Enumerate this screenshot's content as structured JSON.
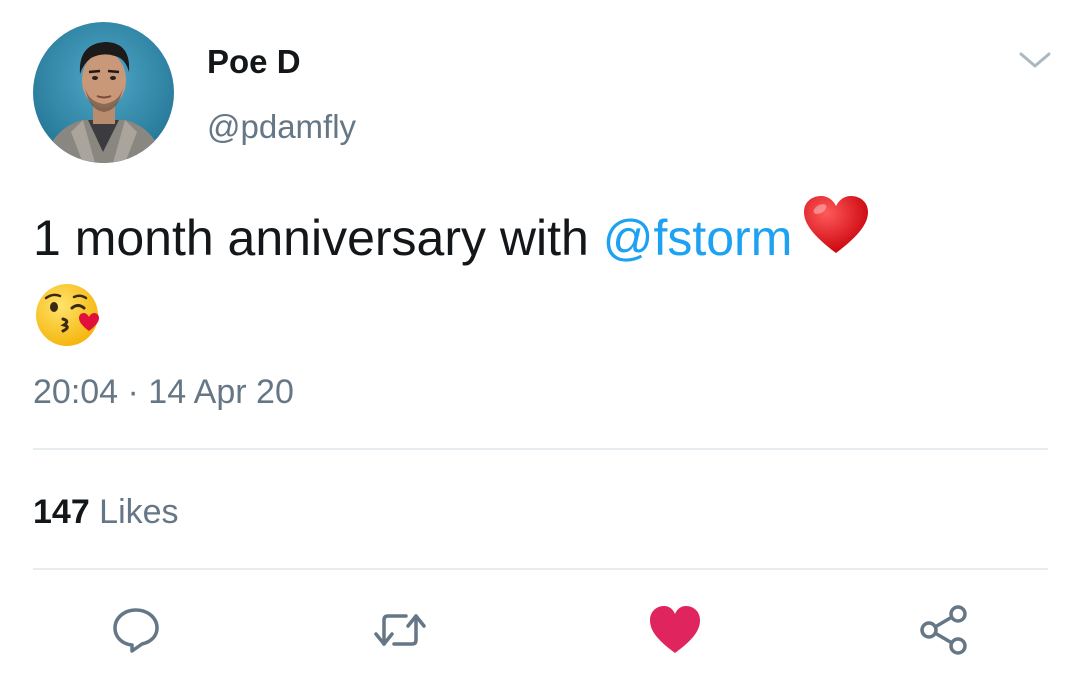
{
  "author": {
    "display_name": "Poe D",
    "handle": "@pdamfly",
    "avatar_icon": "profile-photo"
  },
  "tweet": {
    "text_before": "1 month anniversary with ",
    "mention": "@fstorm",
    "emoji_1": "red-heart-emoji",
    "emoji_2": "face-blowing-kiss-emoji",
    "timestamp": "20:04 · 14 Apr 20"
  },
  "stats": {
    "likes_count": "147",
    "likes_label": " Likes"
  },
  "actions": {
    "reply_icon": "reply-icon",
    "retweet_icon": "retweet-icon",
    "like_icon": "heart-icon",
    "share_icon": "share-icon"
  },
  "colors": {
    "text": "#14171a",
    "secondary": "#657786",
    "link": "#1da1f2",
    "liked": "#e0245e",
    "divider": "#e6ecf0"
  }
}
